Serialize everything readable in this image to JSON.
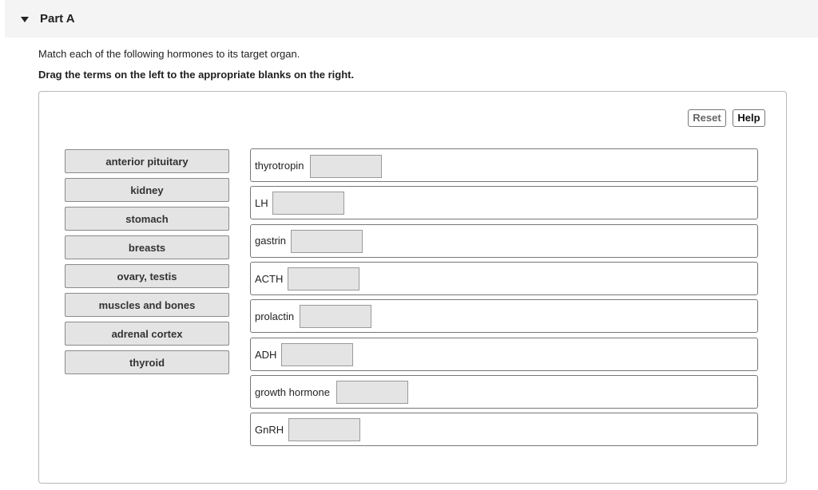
{
  "part": {
    "title": "Part A"
  },
  "instructions": {
    "line1": "Match each of the following hormones to its target organ.",
    "line2": "Drag the terms on the left to the appropriate blanks on the right."
  },
  "toolbar": {
    "reset_label": "Reset",
    "help_label": "Help"
  },
  "terms": [
    "anterior pituitary",
    "kidney",
    "stomach",
    "breasts",
    "ovary, testis",
    "muscles and bones",
    "adrenal cortex",
    "thyroid"
  ],
  "targets": [
    {
      "label": "thyrotropin",
      "answer": ""
    },
    {
      "label": "LH",
      "answer": ""
    },
    {
      "label": "gastrin",
      "answer": ""
    },
    {
      "label": "ACTH",
      "answer": ""
    },
    {
      "label": "prolactin",
      "answer": ""
    },
    {
      "label": "ADH",
      "answer": ""
    },
    {
      "label": "growth hormone",
      "answer": ""
    },
    {
      "label": "GnRH",
      "answer": ""
    }
  ]
}
